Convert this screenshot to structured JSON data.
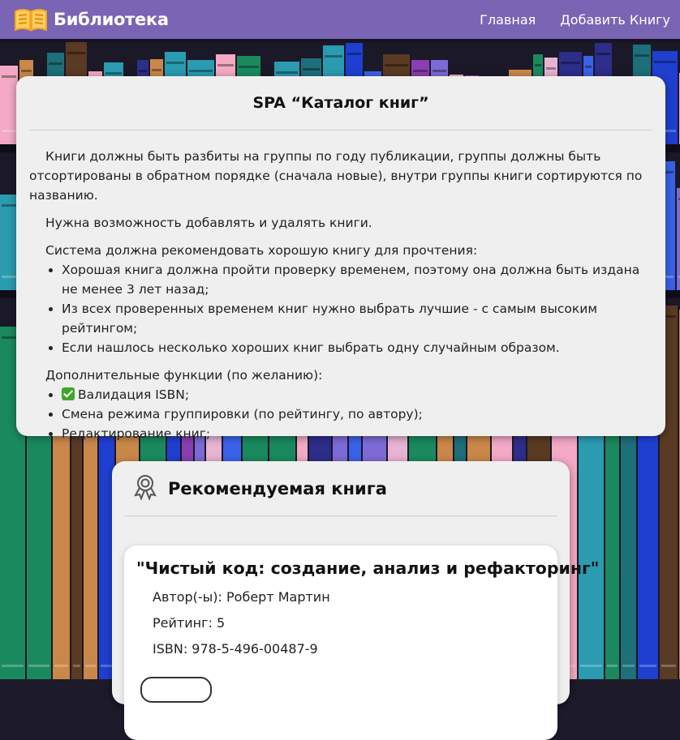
{
  "header": {
    "logo_icon": "open-book-icon",
    "title": "Библиотека",
    "nav": [
      {
        "label": "Главная"
      },
      {
        "label": "Добавить Книгу"
      }
    ],
    "background_color": "#7a64b4"
  },
  "description": {
    "title": "SPA “Каталог книг”",
    "paragraph1": "Книги должны быть разбиты на группы по году публикации, группы должны быть отсортированы в обратном порядке (сначала новые), внутри группы книги сортируются по названию.",
    "paragraph2": "Нужна возможность добавлять и удалять книги.",
    "recommend_intro": "Система должна рекомендовать хорошую книгу для прочтения:",
    "recommend_rules": [
      "Хорошая книга должна пройти проверку временем, поэтому она должна быть издана не менее 3 лет назад;",
      "Из всех проверенных временем книг нужно выбрать лучшие - с самым высоким рейтингом;",
      "Если нашлось несколько хороших книг выбрать одну случайным образом."
    ],
    "extras_intro": "Дополнительные функции (по желанию):",
    "extras": [
      {
        "icon": "checkmark-icon",
        "text": "Валидация ISBN;"
      },
      {
        "text": "Смена режима группировки (по рейтингу, по автору);"
      },
      {
        "text": "Редактирование книг;"
      }
    ]
  },
  "recommended": {
    "icon": "award-icon",
    "title": "Рекомендуемая книга",
    "book": {
      "title": "\"Чистый код: создание, анализ и рефакторинг\"",
      "authors": "Автор(-ы): Роберт Мартин",
      "rating": "Рейтинг: 5",
      "isbn": "ISBN: 978-5-496-00487-9"
    }
  }
}
